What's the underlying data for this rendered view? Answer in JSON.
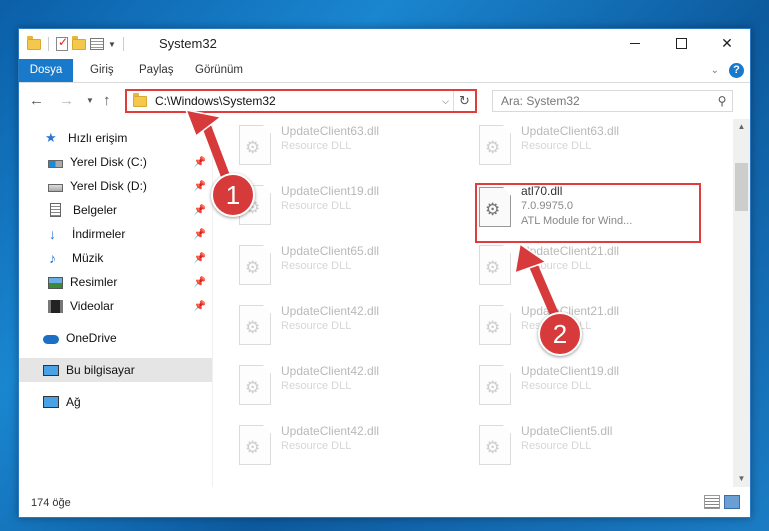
{
  "window": {
    "title": "System32",
    "controls": {
      "minimize": "",
      "maximize": "",
      "close": "✕"
    }
  },
  "ribbon": {
    "tabs": [
      "Dosya",
      "Giriş",
      "Paylaş",
      "Görünüm"
    ],
    "help": "?"
  },
  "navbar": {
    "address": "C:\\Windows\\System32",
    "search_placeholder": "Ara: System32"
  },
  "sidebar": {
    "items": [
      {
        "label": "Hızlı erişim",
        "icon": "star-icon"
      },
      {
        "label": "Yerel Disk (C:)",
        "icon": "windows-disk-icon",
        "pinned": true
      },
      {
        "label": "Yerel Disk (D:)",
        "icon": "disk-icon",
        "pinned": true
      },
      {
        "label": "Belgeler",
        "icon": "documents-icon",
        "pinned": true
      },
      {
        "label": "İndirmeler",
        "icon": "download-icon",
        "pinned": true
      },
      {
        "label": "Müzik",
        "icon": "music-icon",
        "pinned": true
      },
      {
        "label": "Resimler",
        "icon": "pictures-icon",
        "pinned": true
      },
      {
        "label": "Videolar",
        "icon": "videos-icon",
        "pinned": true
      },
      {
        "label": "OneDrive",
        "icon": "onedrive-icon"
      },
      {
        "label": "Bu bilgisayar",
        "icon": "this-pc-icon",
        "selected": true
      },
      {
        "label": "Ağ",
        "icon": "network-icon"
      }
    ]
  },
  "files": [
    {
      "name": "UpdateClient63.dll",
      "sub": "Resource DLL"
    },
    {
      "name": "UpdateClient63.dll",
      "sub": "Resource DLL"
    },
    {
      "name": "UpdateClient19.dll",
      "sub": "Resource DLL"
    },
    {
      "name": "atl70.dll",
      "sub": "7.0.9975.0",
      "sub2": "ATL Module for Wind...",
      "highlighted": true
    },
    {
      "name": "UpdateClient65.dll",
      "sub": "Resource DLL"
    },
    {
      "name": "UpdateClient21.dll",
      "sub": "Resource DLL"
    },
    {
      "name": "UpdateClient42.dll",
      "sub": "Resource DLL"
    },
    {
      "name": "UpdateClient21.dll",
      "sub": "Resource DLL"
    },
    {
      "name": "UpdateClient42.dll",
      "sub": "Resource DLL"
    },
    {
      "name": "UpdateClient19.dll",
      "sub": "Resource DLL"
    },
    {
      "name": "UpdateClient42.dll",
      "sub": "Resource DLL"
    },
    {
      "name": "UpdateClient5.dll",
      "sub": "Resource DLL"
    }
  ],
  "status": {
    "count": "174 öğe"
  },
  "annotations": {
    "badge1": "1",
    "badge2": "2",
    "color": "#d63a3a"
  }
}
